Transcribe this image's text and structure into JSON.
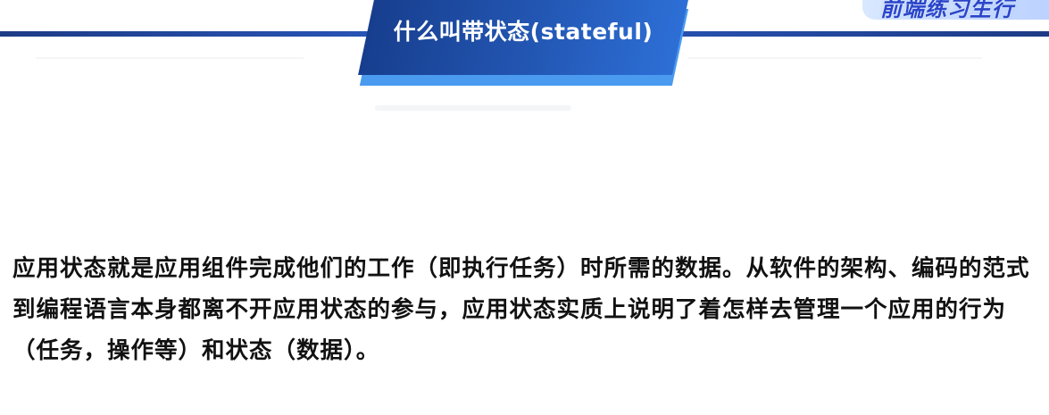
{
  "slide": {
    "title": "什么叫带状态(stateful)",
    "corner_logo_text": "前端练习生行",
    "body_text": "应用状态就是应用组件完成他们的工作（即执行任务）时所需的数据。从软件的架构、编码的范式到编程语言本身都离不开应用状态的参与，应用状态实质上说明了着怎样去管理一个应用的行为（任务，操作等）和状态（数据）。"
  },
  "colors": {
    "banner_dark": "#173e8e",
    "banner_light": "#2d6fd6",
    "banner_shadow": "#4a9af0",
    "top_line": "#1d3b86",
    "text": "#111111"
  }
}
